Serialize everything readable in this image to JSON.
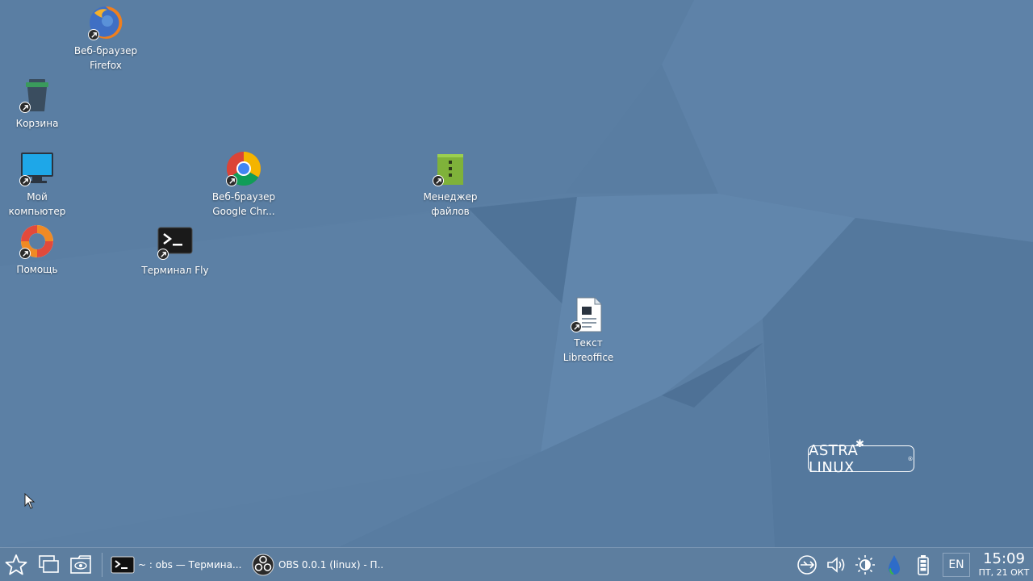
{
  "desktop": {
    "icons": [
      {
        "label1": "Веб-браузер",
        "label2": "Firefox",
        "icon": "firefox-icon"
      },
      {
        "label1": "Корзина",
        "label2": "",
        "icon": "trash-icon"
      },
      {
        "label1": "Мой",
        "label2": "компьютер",
        "icon": "computer-icon"
      },
      {
        "label1": "Веб-браузер",
        "label2": "Google Chr...",
        "icon": "chrome-icon"
      },
      {
        "label1": "Менеджер",
        "label2": "файлов",
        "icon": "file-manager-icon"
      },
      {
        "label1": "Помощь",
        "label2": "",
        "icon": "help-icon"
      },
      {
        "label1": "Терминал Fly",
        "label2": "",
        "icon": "terminal-icon"
      },
      {
        "label1": "Текст",
        "label2": "Libreoffice",
        "icon": "document-icon"
      }
    ],
    "logo_text": "ASTRA LINUX"
  },
  "taskbar": {
    "tasks": [
      {
        "label": "~ : obs — Термина...",
        "icon": "terminal-icon"
      },
      {
        "label": "OBS 0.0.1 (linux) - П...",
        "icon": "obs-icon"
      }
    ],
    "language": "EN",
    "time": "15:09",
    "date": "ПТ, 21 ОКТ"
  },
  "colors": {
    "wallpaper": "#5a7ea3",
    "panel": "#5d7e9f"
  }
}
